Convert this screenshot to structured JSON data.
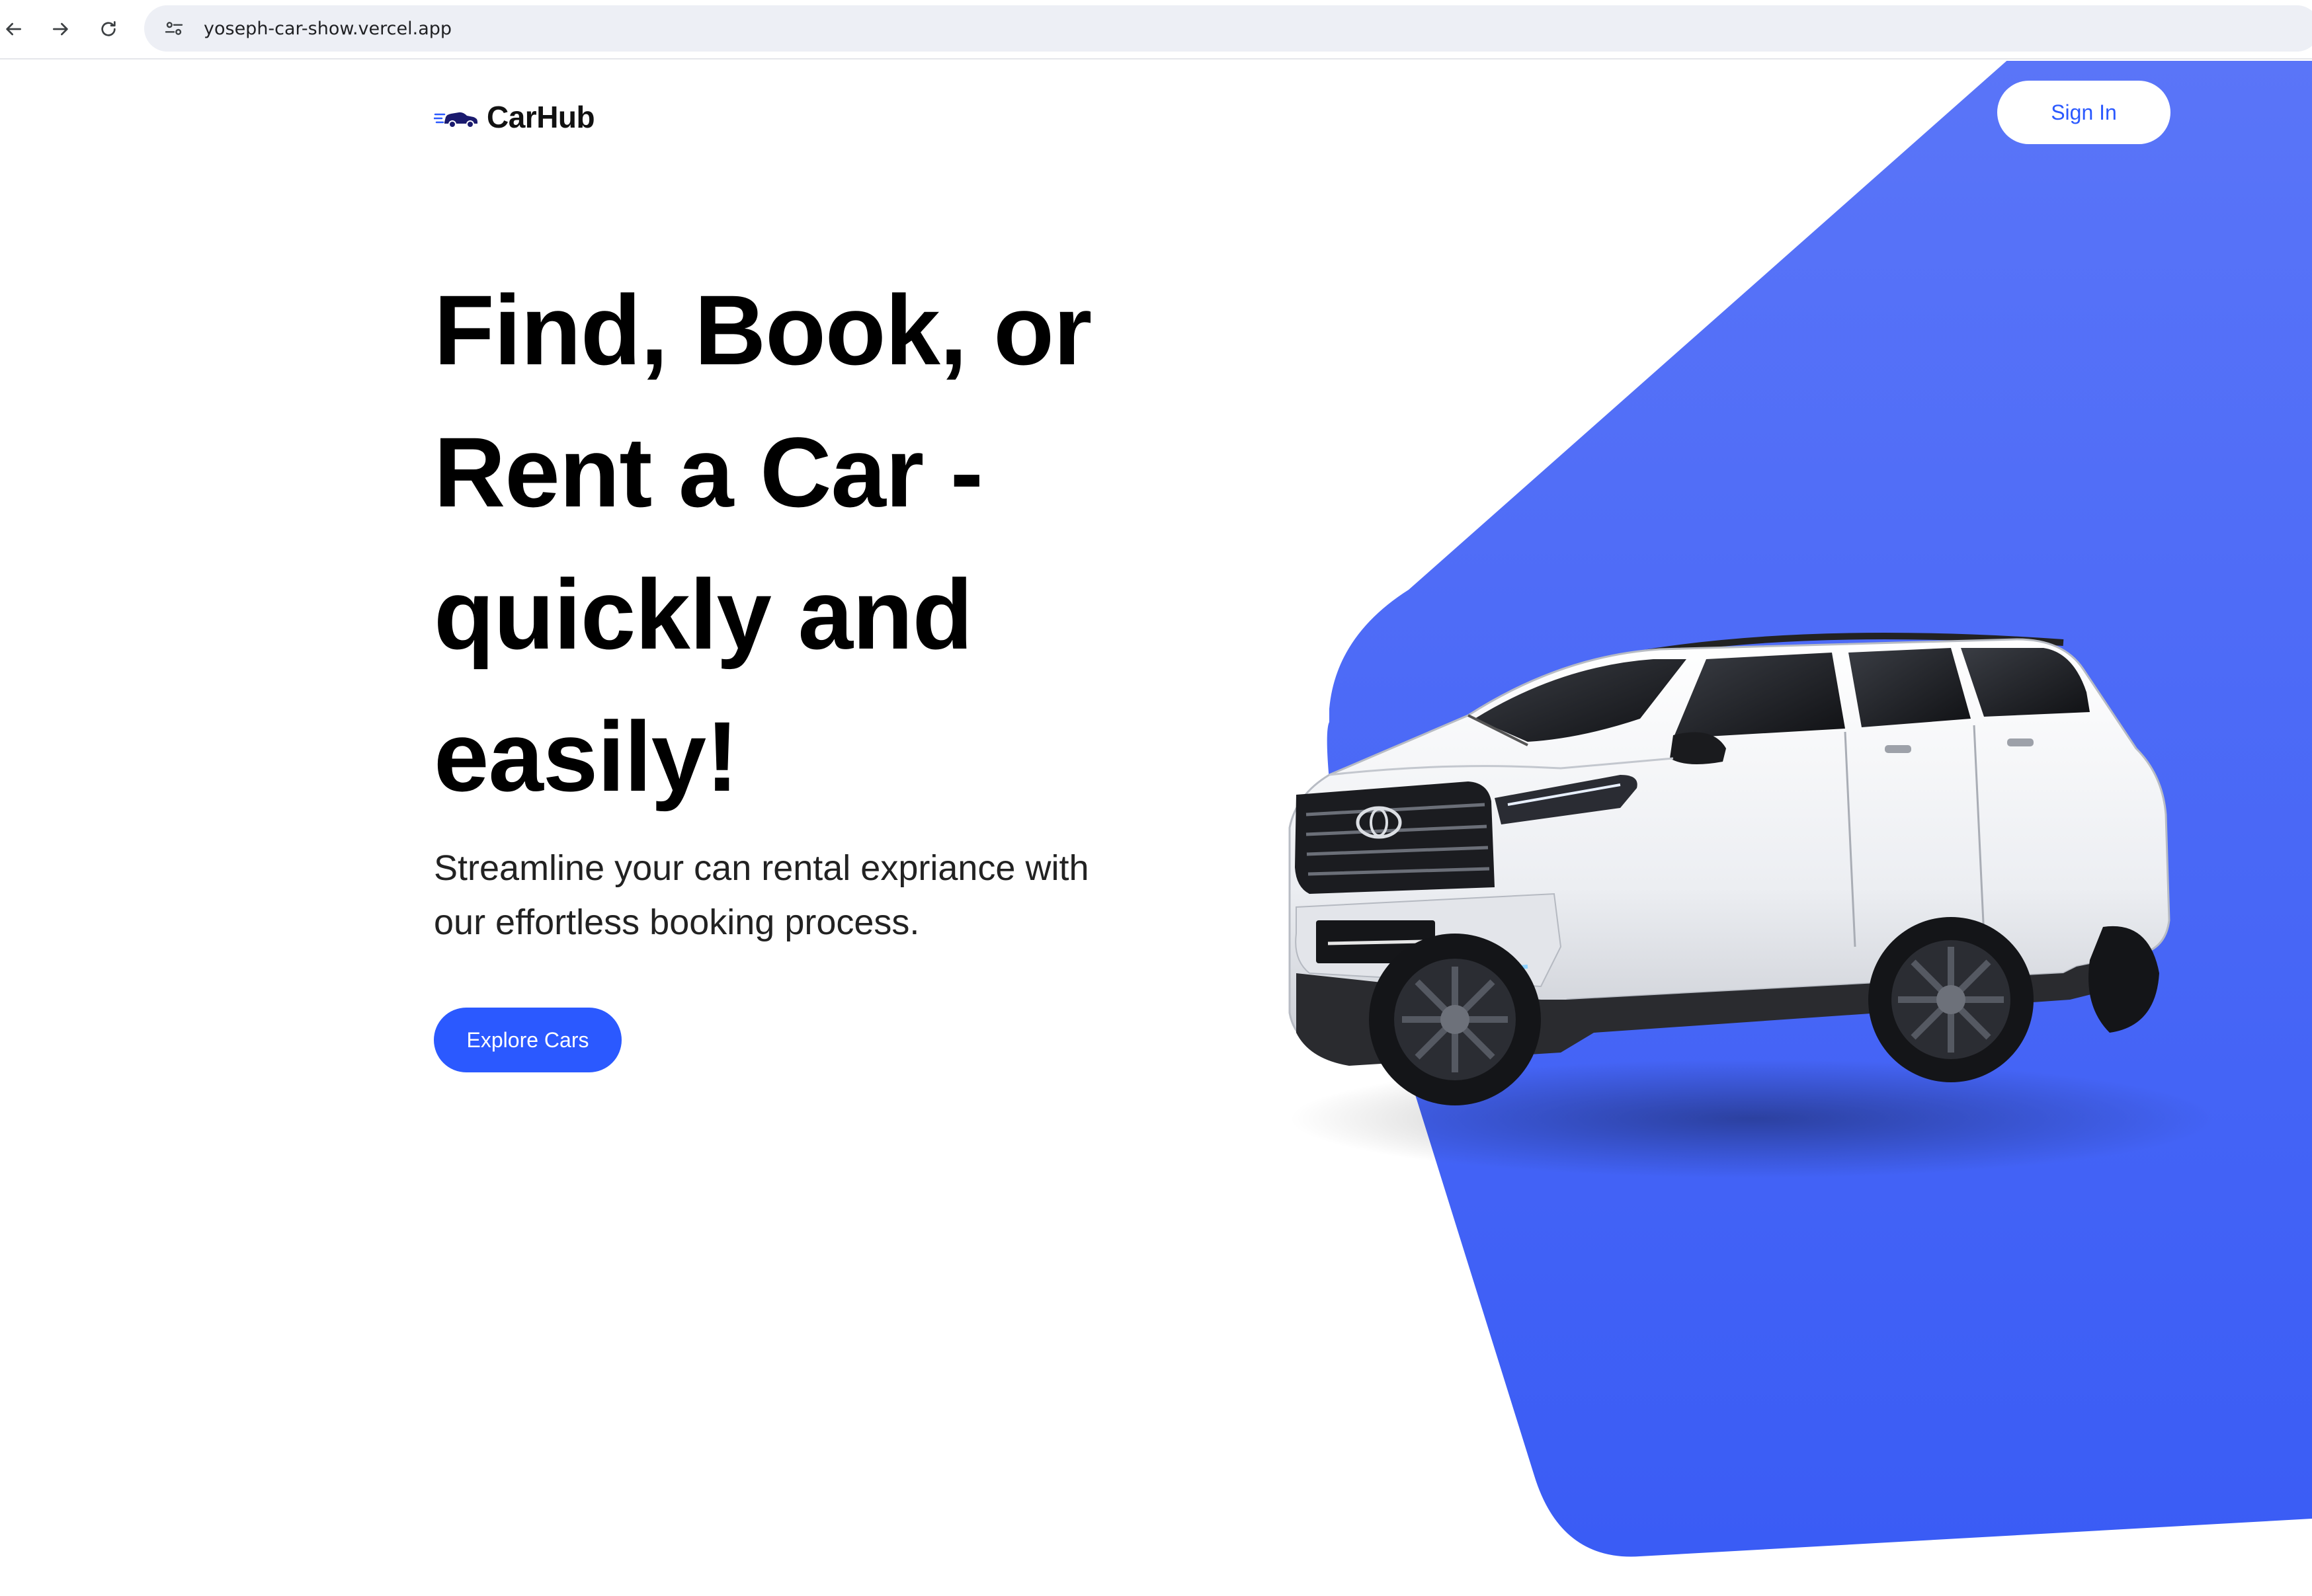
{
  "browser": {
    "url": "yoseph-car-show.vercel.app",
    "icons": [
      "back-arrow-icon",
      "forward-arrow-icon",
      "reload-icon",
      "site-settings-icon"
    ]
  },
  "header": {
    "logo_text": "CarHub",
    "logo_icon": "car-icon",
    "signin_label": "Sign In"
  },
  "hero": {
    "title_lines": [
      "Find, Book, or",
      "Rent a Car -",
      "quickly and",
      "easily!"
    ],
    "subtitle_lines": [
      "Streamline your can rental expriance with",
      "our effortless booking process."
    ],
    "cta_label": "Explore Cars",
    "image": "white-suv"
  },
  "colors": {
    "accent": "#2b59ff",
    "hero_gradient_top": "#5a75f8",
    "hero_gradient_bottom": "#3a5cf5",
    "text": "#000000"
  }
}
